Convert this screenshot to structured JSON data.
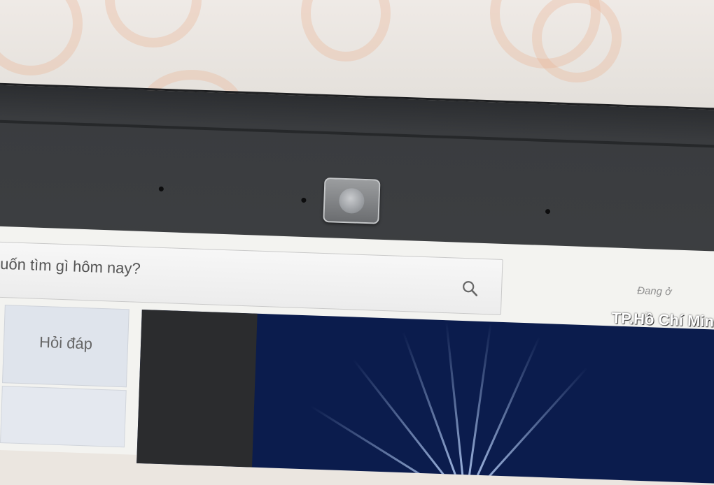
{
  "search": {
    "placeholder": "muốn tìm gì hôm nay?",
    "icon": "search-icon"
  },
  "location": {
    "label": "Đang ở",
    "value": "TP.Hồ Chí Minh"
  },
  "tiles": {
    "help_label": "Hỏi đáp"
  },
  "colors": {
    "bezel": "#3a3c3f",
    "banner": "#0b1c4d",
    "tile_red": "#7e2b2c",
    "tile_help": "#dfe4ec"
  }
}
